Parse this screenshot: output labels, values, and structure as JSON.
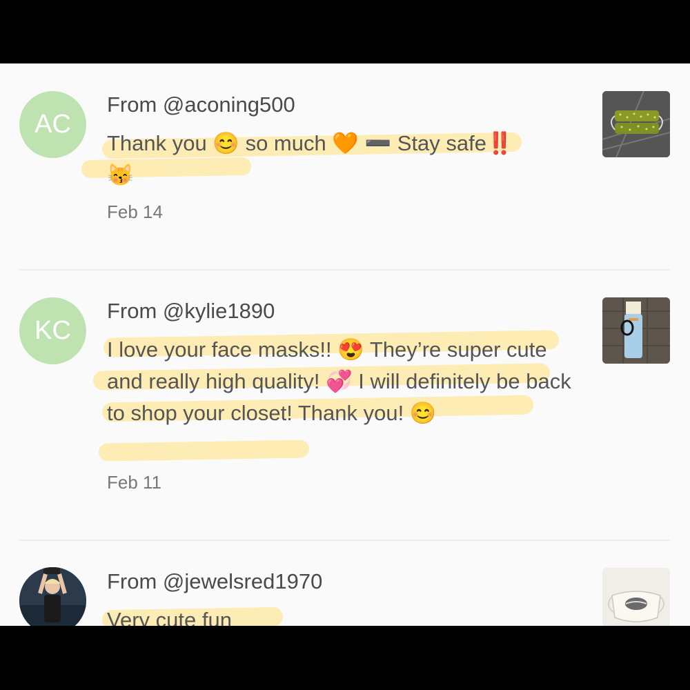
{
  "reviews": [
    {
      "initials": "AC",
      "from": "From @aconing500",
      "message": "Thank you 😊 so much 🧡 ➖ Stay safe‼️ 😽",
      "date": "Feb 14",
      "avatar_color": "#bfe3b0"
    },
    {
      "initials": "KC",
      "from": "From @kylie1890",
      "message": "I love your face masks!! 😍 They’re super cute and really high quality! 💞 I will definitely be back to shop your closet! Thank you! 😊",
      "date": "Feb 11",
      "avatar_color": "#bfe3b0"
    },
    {
      "initials": "",
      "from": "From @jewelsred1970",
      "message": "Very cute fun",
      "date": ""
    }
  ],
  "colors": {
    "highlight": "#ffe078",
    "background": "#fafafa",
    "text": "#555555"
  }
}
